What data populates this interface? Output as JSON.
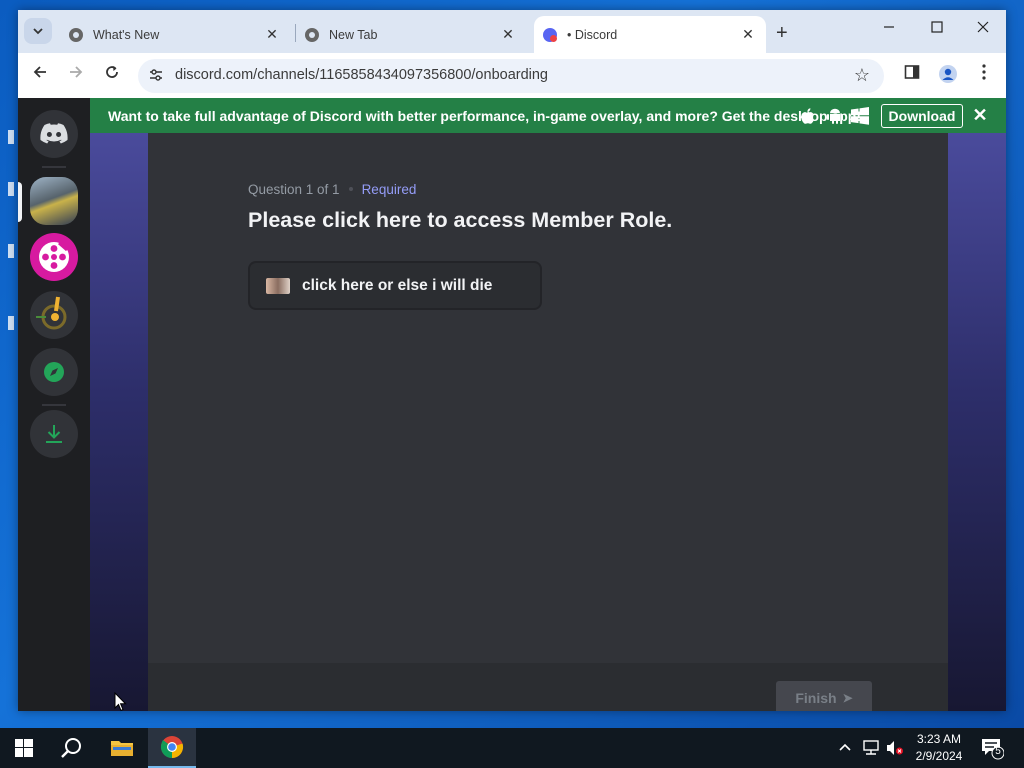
{
  "browser": {
    "tabs": [
      {
        "title": "What's New",
        "active": false
      },
      {
        "title": "New Tab",
        "active": false
      },
      {
        "title": "• Discord",
        "active": true
      }
    ],
    "new_tab_label": "+",
    "close_label": "✕",
    "url": "discord.com/channels/1165858434097356800/onboarding"
  },
  "banner": {
    "message": "Want to take full advantage of Discord with better performance, in-game overlay, and more? Get the desktop app!",
    "download_label": "Download",
    "close_label": "✕",
    "color": "#248046"
  },
  "servers": [
    {
      "name": "discord-home-icon"
    },
    {
      "name": "server-landscape-icon"
    },
    {
      "name": "server-film-reel-icon"
    },
    {
      "name": "server-explosion-icon"
    },
    {
      "name": "explore-servers-icon"
    },
    {
      "name": "download-apps-icon"
    }
  ],
  "onboarding": {
    "progress": "Question 1 of 1",
    "required_label": "Required",
    "question": "Please click here to access Member Role.",
    "option_label": "click here or else i will die",
    "finish_label": "Finish"
  },
  "taskbar": {
    "time": "3:23 AM",
    "date": "2/9/2024",
    "notification_count": "5"
  },
  "colors": {
    "discord_blurple": "#5865f2",
    "panel_bg": "#313338",
    "accent_required": "#949cf7"
  }
}
